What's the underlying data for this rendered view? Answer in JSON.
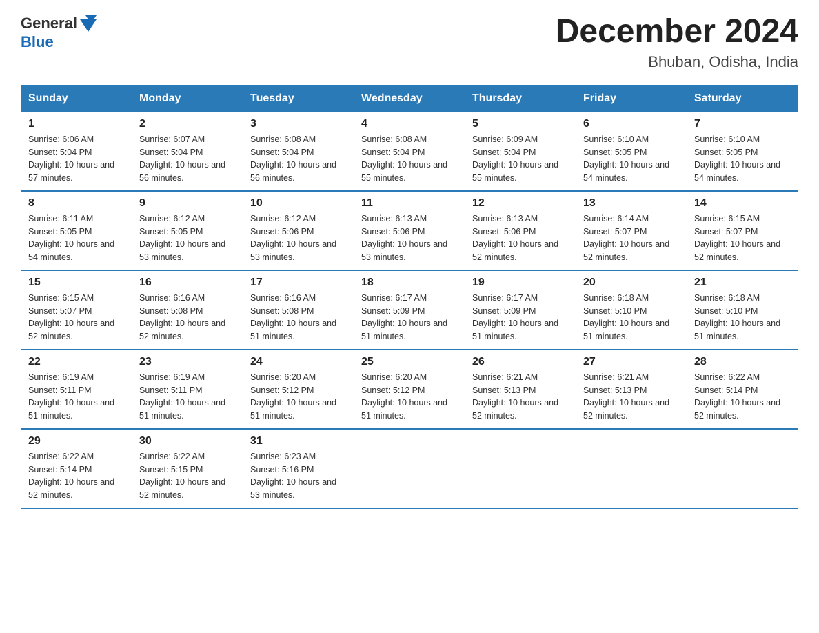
{
  "header": {
    "logo_general": "General",
    "logo_blue": "Blue",
    "month_title": "December 2024",
    "location": "Bhuban, Odisha, India"
  },
  "days_of_week": [
    "Sunday",
    "Monday",
    "Tuesday",
    "Wednesday",
    "Thursday",
    "Friday",
    "Saturday"
  ],
  "weeks": [
    [
      {
        "day": "1",
        "sunrise": "6:06 AM",
        "sunset": "5:04 PM",
        "daylight": "10 hours and 57 minutes."
      },
      {
        "day": "2",
        "sunrise": "6:07 AM",
        "sunset": "5:04 PM",
        "daylight": "10 hours and 56 minutes."
      },
      {
        "day": "3",
        "sunrise": "6:08 AM",
        "sunset": "5:04 PM",
        "daylight": "10 hours and 56 minutes."
      },
      {
        "day": "4",
        "sunrise": "6:08 AM",
        "sunset": "5:04 PM",
        "daylight": "10 hours and 55 minutes."
      },
      {
        "day": "5",
        "sunrise": "6:09 AM",
        "sunset": "5:04 PM",
        "daylight": "10 hours and 55 minutes."
      },
      {
        "day": "6",
        "sunrise": "6:10 AM",
        "sunset": "5:05 PM",
        "daylight": "10 hours and 54 minutes."
      },
      {
        "day": "7",
        "sunrise": "6:10 AM",
        "sunset": "5:05 PM",
        "daylight": "10 hours and 54 minutes."
      }
    ],
    [
      {
        "day": "8",
        "sunrise": "6:11 AM",
        "sunset": "5:05 PM",
        "daylight": "10 hours and 54 minutes."
      },
      {
        "day": "9",
        "sunrise": "6:12 AM",
        "sunset": "5:05 PM",
        "daylight": "10 hours and 53 minutes."
      },
      {
        "day": "10",
        "sunrise": "6:12 AM",
        "sunset": "5:06 PM",
        "daylight": "10 hours and 53 minutes."
      },
      {
        "day": "11",
        "sunrise": "6:13 AM",
        "sunset": "5:06 PM",
        "daylight": "10 hours and 53 minutes."
      },
      {
        "day": "12",
        "sunrise": "6:13 AM",
        "sunset": "5:06 PM",
        "daylight": "10 hours and 52 minutes."
      },
      {
        "day": "13",
        "sunrise": "6:14 AM",
        "sunset": "5:07 PM",
        "daylight": "10 hours and 52 minutes."
      },
      {
        "day": "14",
        "sunrise": "6:15 AM",
        "sunset": "5:07 PM",
        "daylight": "10 hours and 52 minutes."
      }
    ],
    [
      {
        "day": "15",
        "sunrise": "6:15 AM",
        "sunset": "5:07 PM",
        "daylight": "10 hours and 52 minutes."
      },
      {
        "day": "16",
        "sunrise": "6:16 AM",
        "sunset": "5:08 PM",
        "daylight": "10 hours and 52 minutes."
      },
      {
        "day": "17",
        "sunrise": "6:16 AM",
        "sunset": "5:08 PM",
        "daylight": "10 hours and 51 minutes."
      },
      {
        "day": "18",
        "sunrise": "6:17 AM",
        "sunset": "5:09 PM",
        "daylight": "10 hours and 51 minutes."
      },
      {
        "day": "19",
        "sunrise": "6:17 AM",
        "sunset": "5:09 PM",
        "daylight": "10 hours and 51 minutes."
      },
      {
        "day": "20",
        "sunrise": "6:18 AM",
        "sunset": "5:10 PM",
        "daylight": "10 hours and 51 minutes."
      },
      {
        "day": "21",
        "sunrise": "6:18 AM",
        "sunset": "5:10 PM",
        "daylight": "10 hours and 51 minutes."
      }
    ],
    [
      {
        "day": "22",
        "sunrise": "6:19 AM",
        "sunset": "5:11 PM",
        "daylight": "10 hours and 51 minutes."
      },
      {
        "day": "23",
        "sunrise": "6:19 AM",
        "sunset": "5:11 PM",
        "daylight": "10 hours and 51 minutes."
      },
      {
        "day": "24",
        "sunrise": "6:20 AM",
        "sunset": "5:12 PM",
        "daylight": "10 hours and 51 minutes."
      },
      {
        "day": "25",
        "sunrise": "6:20 AM",
        "sunset": "5:12 PM",
        "daylight": "10 hours and 51 minutes."
      },
      {
        "day": "26",
        "sunrise": "6:21 AM",
        "sunset": "5:13 PM",
        "daylight": "10 hours and 52 minutes."
      },
      {
        "day": "27",
        "sunrise": "6:21 AM",
        "sunset": "5:13 PM",
        "daylight": "10 hours and 52 minutes."
      },
      {
        "day": "28",
        "sunrise": "6:22 AM",
        "sunset": "5:14 PM",
        "daylight": "10 hours and 52 minutes."
      }
    ],
    [
      {
        "day": "29",
        "sunrise": "6:22 AM",
        "sunset": "5:14 PM",
        "daylight": "10 hours and 52 minutes."
      },
      {
        "day": "30",
        "sunrise": "6:22 AM",
        "sunset": "5:15 PM",
        "daylight": "10 hours and 52 minutes."
      },
      {
        "day": "31",
        "sunrise": "6:23 AM",
        "sunset": "5:16 PM",
        "daylight": "10 hours and 53 minutes."
      },
      null,
      null,
      null,
      null
    ]
  ]
}
